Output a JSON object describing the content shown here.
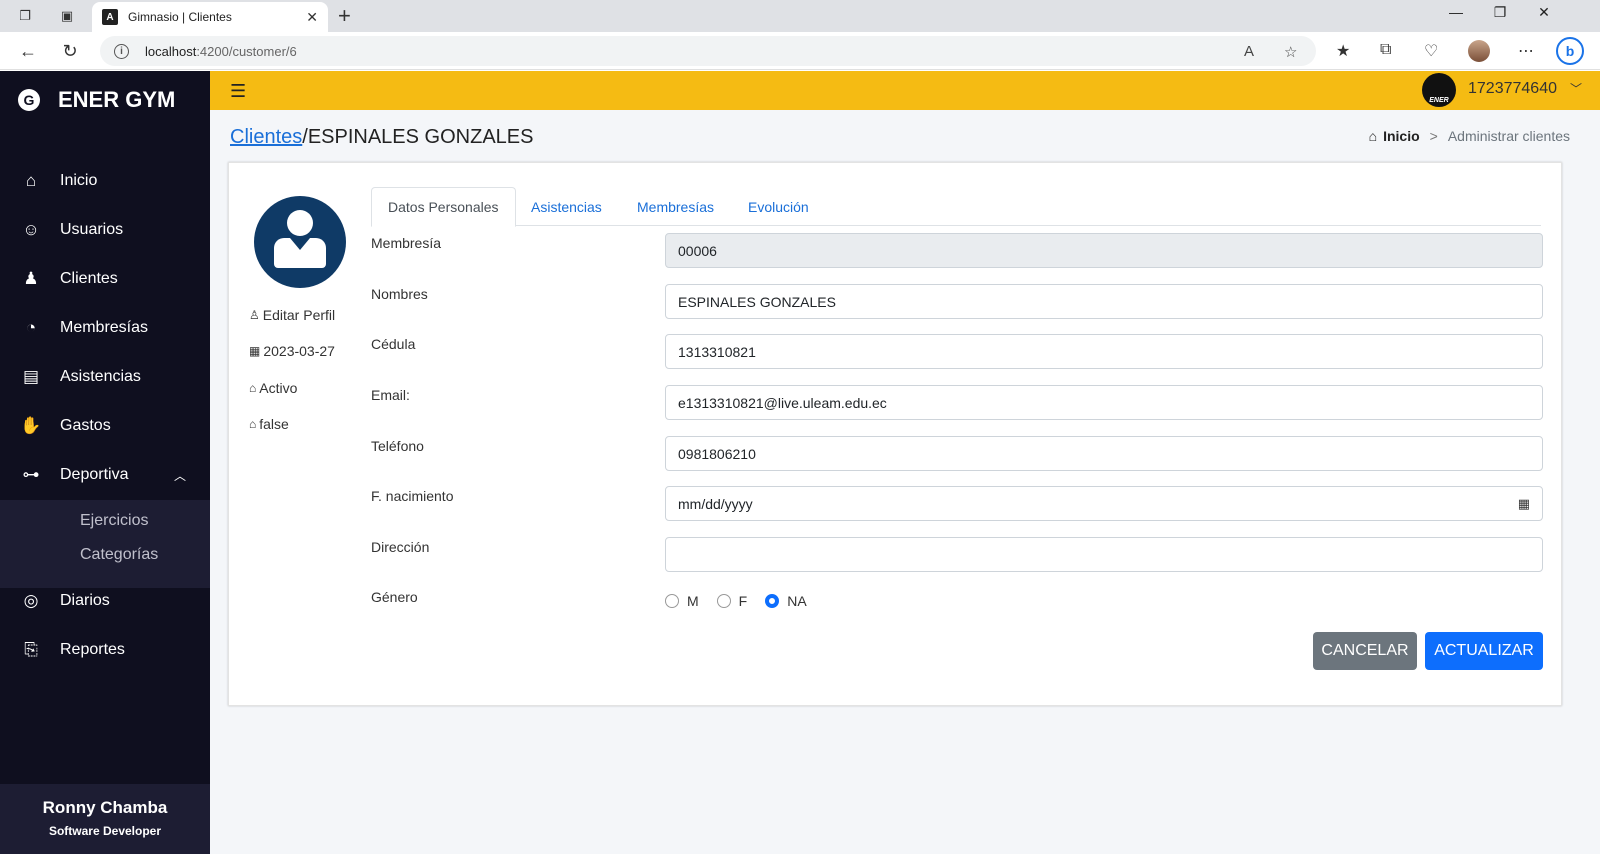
{
  "browser": {
    "tab_title": "Gimnasio | Clientes",
    "tab_favicon": "A",
    "url_host": "localhost",
    "url_path": ":4200/customer/6"
  },
  "sidebar": {
    "brand": "ENER GYM",
    "items": [
      {
        "label": "Inicio",
        "icon": "home-icon"
      },
      {
        "label": "Usuarios",
        "icon": "users-icon"
      },
      {
        "label": "Clientes",
        "icon": "clients-icon"
      },
      {
        "label": "Membresías",
        "icon": "pie-icon"
      },
      {
        "label": "Asistencias",
        "icon": "clipboard-icon"
      },
      {
        "label": "Gastos",
        "icon": "hand-money-icon"
      },
      {
        "label": "Deportiva",
        "icon": "dumbbell-icon"
      },
      {
        "label": "Diarios",
        "icon": "compass-icon"
      },
      {
        "label": "Reportes",
        "icon": "file-export-icon"
      }
    ],
    "submenu": [
      "Ejercicios",
      "Categorías"
    ],
    "footer": {
      "name": "Ronny Chamba",
      "role": "Software Developer"
    }
  },
  "topbar": {
    "user_id": "1723774640",
    "avatar_text": "ENER"
  },
  "page": {
    "title_link": "Clientes",
    "title_rest": "/ESPINALES GONZALES",
    "breadcrumb_home": "Inicio",
    "breadcrumb_sep": ">",
    "breadcrumb_current": "Administrar clientes"
  },
  "profile": {
    "edit": "Editar Perfil",
    "date": "2023-03-27",
    "status": "Activo",
    "flag": "false"
  },
  "tabs": [
    "Datos Personales",
    "Asistencias",
    "Membresías",
    "Evolución"
  ],
  "form": {
    "membresia_label": "Membresía",
    "membresia_value": "00006",
    "nombres_label": "Nombres",
    "nombres_value": "ESPINALES GONZALES",
    "cedula_label": "Cédula",
    "cedula_value": "1313310821",
    "email_label": "Email:",
    "email_value": "e1313310821@live.uleam.edu.ec",
    "telefono_label": "Teléfono",
    "telefono_value": "0981806210",
    "nacimiento_label": "F. nacimiento",
    "nacimiento_value": "mm/dd/yyyy",
    "direccion_label": "Dirección",
    "direccion_value": "",
    "genero_label": "Género",
    "genero_options": [
      "M",
      "F",
      "NA"
    ],
    "genero_selected": "NA"
  },
  "buttons": {
    "cancel": "CANCELAR",
    "update": "ACTUALIZAR"
  },
  "colors": {
    "sidebar_bg": "#0f0f1f",
    "appbar_bg": "#f5bb13",
    "primary": "#0d6efd",
    "secondary": "#6c757d"
  }
}
